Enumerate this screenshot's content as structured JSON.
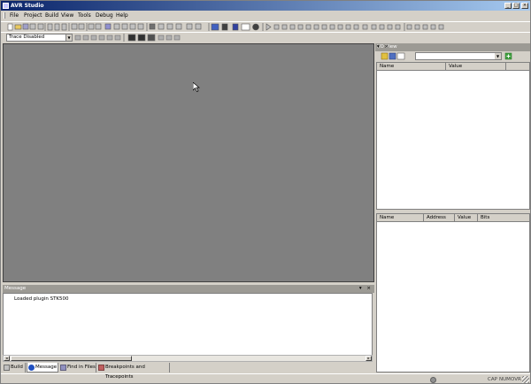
{
  "window": {
    "title": "AVR Studio",
    "controls": {
      "minimize": "_",
      "maximize": "□",
      "close": "×"
    }
  },
  "menubar": {
    "items": [
      "File",
      "Project",
      "Build",
      "View",
      "Tools",
      "Debug",
      "Help"
    ]
  },
  "toolbar2": {
    "trace_select": "Trace Disabled"
  },
  "message_panel": {
    "title": "Message",
    "lines": [
      "Loaded plugin STK500"
    ]
  },
  "bottom_tabs": [
    "Build",
    "Message",
    "Find in Files",
    "Breakpoints and Tracepoints"
  ],
  "io_view": {
    "title": "I/O View",
    "top_columns": [
      "Name",
      "Value"
    ],
    "bottom_columns": [
      "Name",
      "Address",
      "Value",
      "Bits"
    ]
  },
  "status_bar": {
    "indicators": [
      "CAP",
      "NUM",
      "OVR"
    ]
  },
  "colors": {
    "title_start": "#0a246a",
    "title_end": "#a6caf0",
    "chrome": "#d4d0c8",
    "workspace": "#808080"
  }
}
